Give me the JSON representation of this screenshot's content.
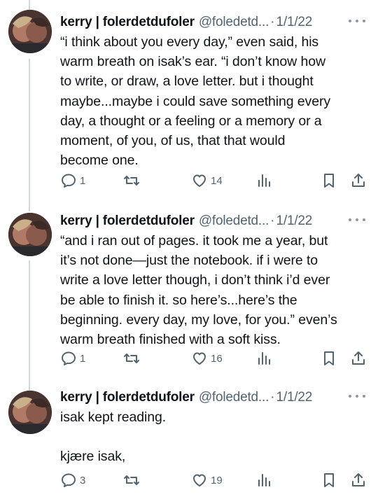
{
  "tweets": [
    {
      "author": "kerry | folerdetdufoler",
      "handle": "@foledetd...",
      "separator": "·",
      "date": "1/1/22",
      "text": "“i think about you every day,” even said, his\nwarm breath on isak’s ear. “i don’t know how\nto write, or draw, a love letter. but i thought\nmaybe...maybe i could save something every\nday, a thought or a feeling or a memory or a\nmoment, of you, of us, that that would\nbecome one.",
      "replies": "1",
      "likes": "14"
    },
    {
      "author": "kerry | folerdetdufoler",
      "handle": "@foledetd...",
      "separator": "·",
      "date": "1/1/22",
      "text": "“and i ran out of pages. it took me a year, but\nit’s not done—just the notebook. if i were to\nwrite a love letter though, i don’t think i’d ever\nbe able to finish it. so here’s...here’s the\nbeginning. every day, my love, for you.” even’s\nwarm breath finished with a soft kiss.",
      "replies": "1",
      "likes": "16"
    },
    {
      "author": "kerry | folerdetdufoler",
      "handle": "@foledetd...",
      "separator": "·",
      "date": "1/1/22",
      "text": "isak kept reading.\n\nkjære isak,",
      "replies": "3",
      "likes": "19"
    }
  ],
  "icons": {
    "reply": "reply-icon",
    "retweet": "retweet-icon",
    "like": "heart-icon",
    "views": "views-icon",
    "bookmark": "bookmark-icon",
    "share": "share-icon",
    "more": "more-icon"
  },
  "colors": {
    "text": "#0f1419",
    "secondary": "#536471",
    "thread_line": "#cfd9de"
  }
}
